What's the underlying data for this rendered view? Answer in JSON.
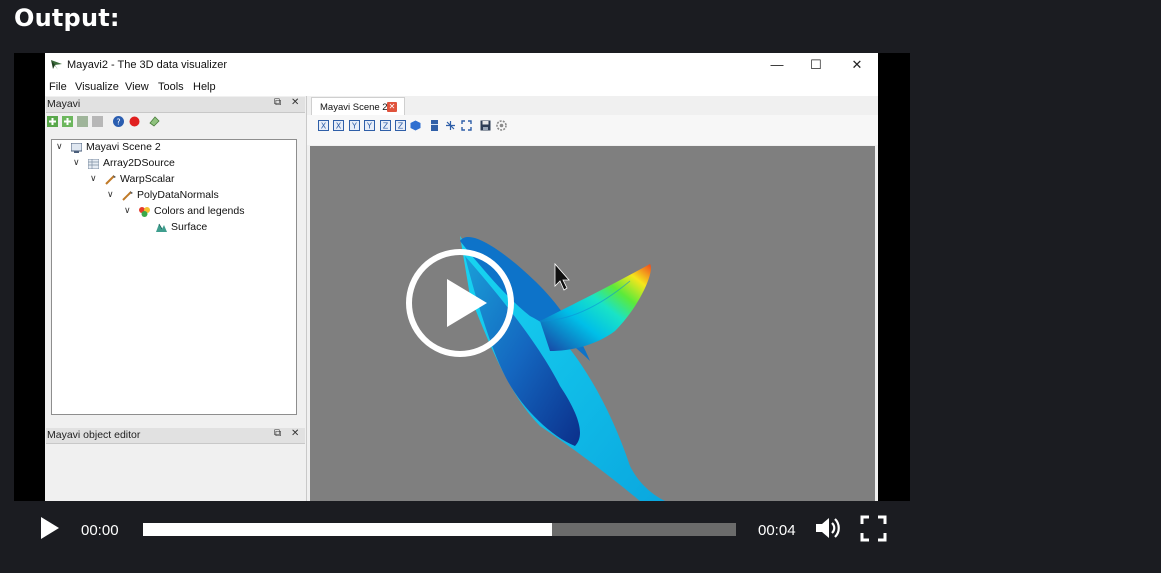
{
  "page": {
    "heading": "Output:"
  },
  "window": {
    "title": "Mayavi2 - The 3D data visualizer",
    "controls": {
      "minimize": "—",
      "maximize": "☐",
      "close": "✕"
    }
  },
  "menu": [
    "File",
    "Visualize",
    "View",
    "Tools",
    "Help"
  ],
  "left_panel": {
    "title": "Mayavi",
    "tree": [
      {
        "label": "Mayavi Scene 2",
        "level": 0,
        "icon": "scene-icon"
      },
      {
        "label": "Array2DSource",
        "level": 1,
        "icon": "array-source-icon"
      },
      {
        "label": "WarpScalar",
        "level": 2,
        "icon": "filter-icon"
      },
      {
        "label": "PolyDataNormals",
        "level": 3,
        "icon": "filter-icon"
      },
      {
        "label": "Colors and legends",
        "level": 4,
        "icon": "colors-icon"
      },
      {
        "label": "Surface",
        "level": 5,
        "icon": "surface-icon"
      }
    ],
    "editor_title": "Mayavi object editor"
  },
  "scene": {
    "tab_label": "Mayavi Scene 2",
    "toolbar_icons": [
      "view-x-minus-icon",
      "view-x-plus-icon",
      "view-y-minus-icon",
      "view-y-plus-icon",
      "view-z-minus-icon",
      "view-z-plus-icon",
      "isometric-view-icon",
      "parallel-projection-icon",
      "axes-icon",
      "fullscreen-icon",
      "save-icon",
      "configure-icon"
    ],
    "background_color": "#7f7f7f"
  },
  "video": {
    "current_time": "00:00",
    "duration": "00:04",
    "progress_fraction": 0.69,
    "accent": "#ffffff"
  }
}
